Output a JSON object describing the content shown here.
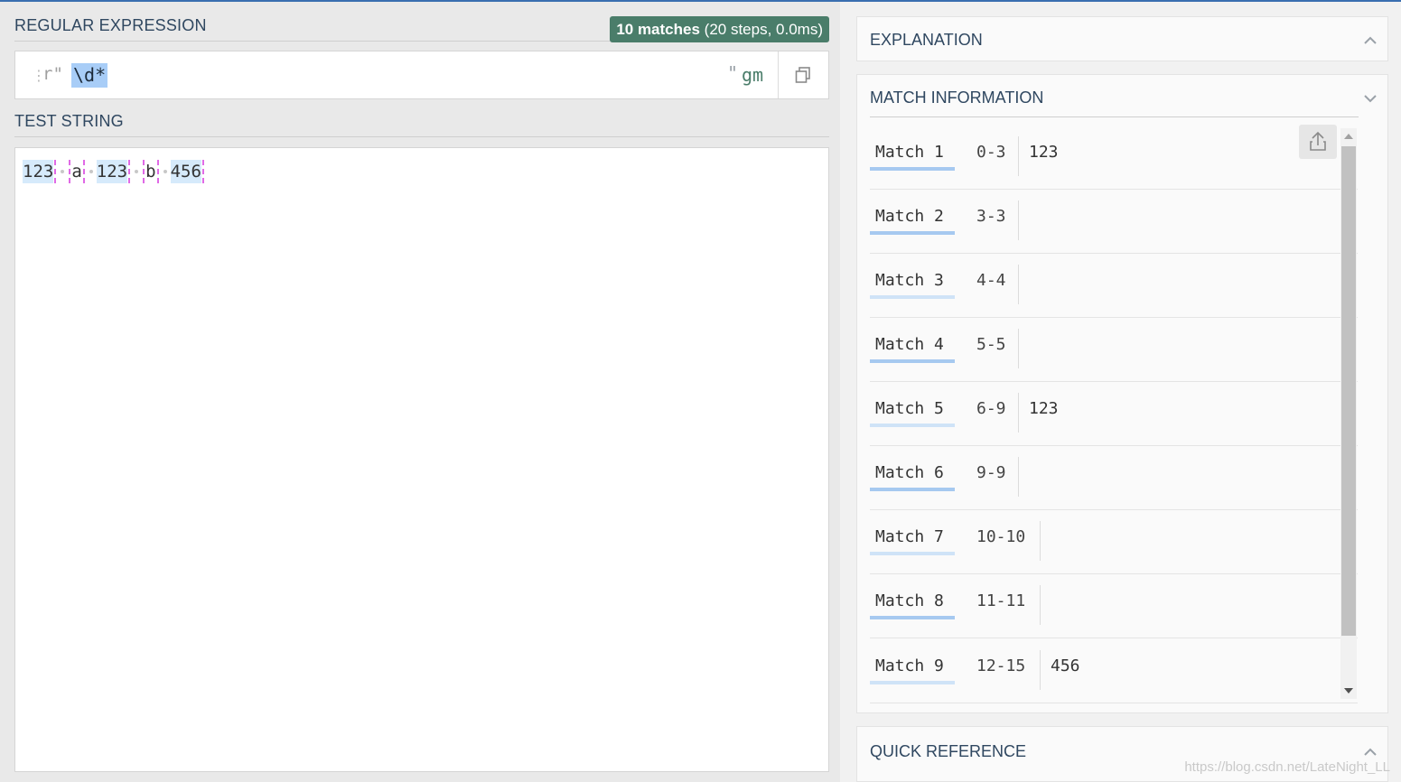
{
  "regex_section": {
    "title": "REGULAR EXPRESSION",
    "badge_bold": "10 matches",
    "badge_rest": " (20 steps, 0.0ms)",
    "grip": "⋮",
    "open_delim": "r\"",
    "pattern": "\\d*",
    "close_delim": "\"",
    "flags": "gm",
    "copy_icon": "copy-icon"
  },
  "test_section": {
    "title": "TEST STRING",
    "tokens": [
      "123",
      "a",
      "123",
      "b",
      "456"
    ]
  },
  "explanation": {
    "title": "EXPLANATION"
  },
  "match_info": {
    "title": "MATCH INFORMATION",
    "share_icon": "share-icon",
    "matches": [
      {
        "label": "Match  1",
        "range": "0-3",
        "value": "123"
      },
      {
        "label": "Match  2",
        "range": "3-3",
        "value": ""
      },
      {
        "label": "Match  3",
        "range": "4-4",
        "value": ""
      },
      {
        "label": "Match  4",
        "range": "5-5",
        "value": ""
      },
      {
        "label": "Match  5",
        "range": "6-9",
        "value": "123"
      },
      {
        "label": "Match  6",
        "range": "9-9",
        "value": ""
      },
      {
        "label": "Match  7",
        "range": "10-10",
        "value": ""
      },
      {
        "label": "Match  8",
        "range": "11-11",
        "value": ""
      },
      {
        "label": "Match  9",
        "range": "12-15",
        "value": "456"
      }
    ]
  },
  "quick_reference": {
    "title": "QUICK REFERENCE"
  },
  "watermark": "https://blog.csdn.net/LateNight_LL"
}
